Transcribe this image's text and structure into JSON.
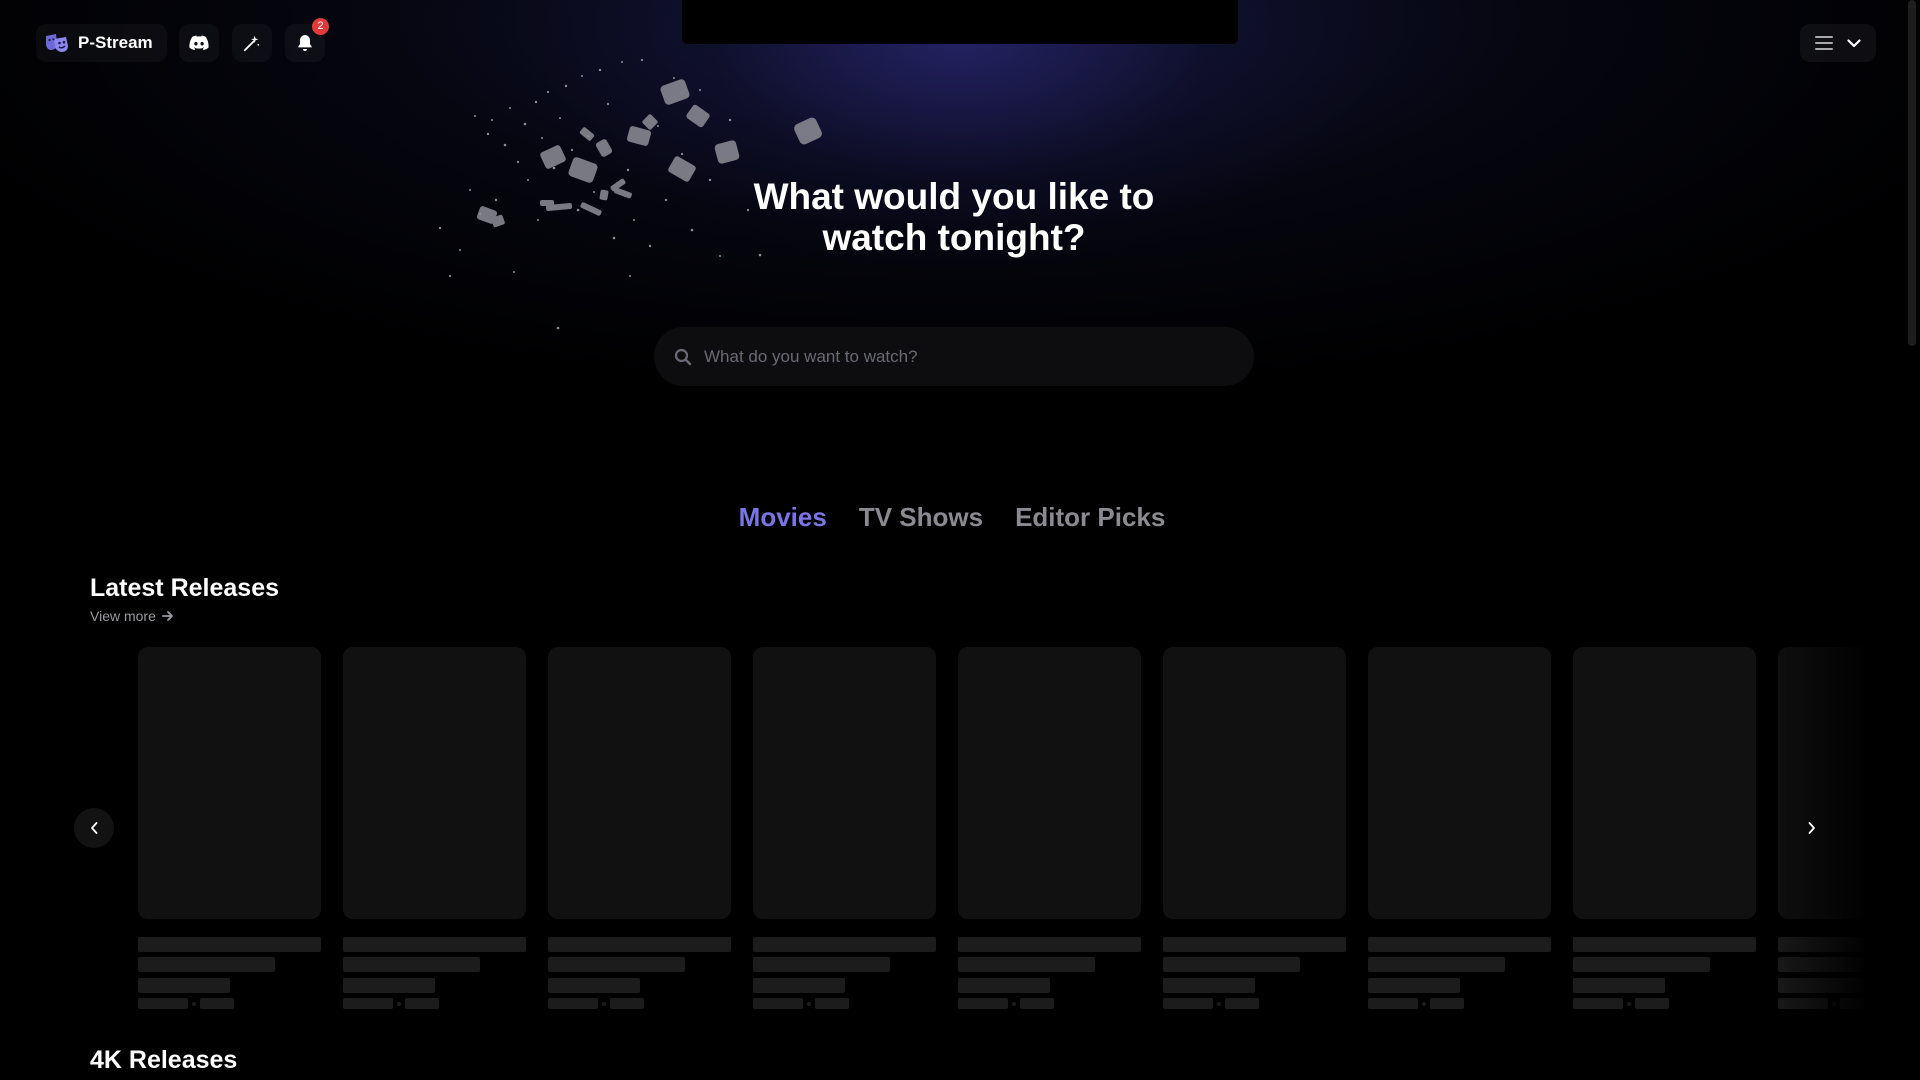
{
  "header": {
    "brand_name": "P-Stream",
    "notification_count": "2",
    "icons": [
      "masks-logo-icon",
      "discord-icon",
      "magic-wand-icon",
      "bell-icon",
      "hamburger-menu-icon",
      "chevron-down-icon"
    ]
  },
  "hero": {
    "title": "What would you like to watch tonight?"
  },
  "search": {
    "placeholder": "What do you want to watch?"
  },
  "tabs": [
    {
      "label": "Movies",
      "active": true
    },
    {
      "label": "TV Shows",
      "active": false
    },
    {
      "label": "Editor Picks",
      "active": false
    }
  ],
  "sections": [
    {
      "title": "Latest Releases",
      "view_more": "View more"
    },
    {
      "title": "4K Releases"
    }
  ],
  "colors": {
    "accent": "#7b74e6",
    "badge": "#e03a3a",
    "background": "#000000",
    "skeleton": "#111111"
  }
}
